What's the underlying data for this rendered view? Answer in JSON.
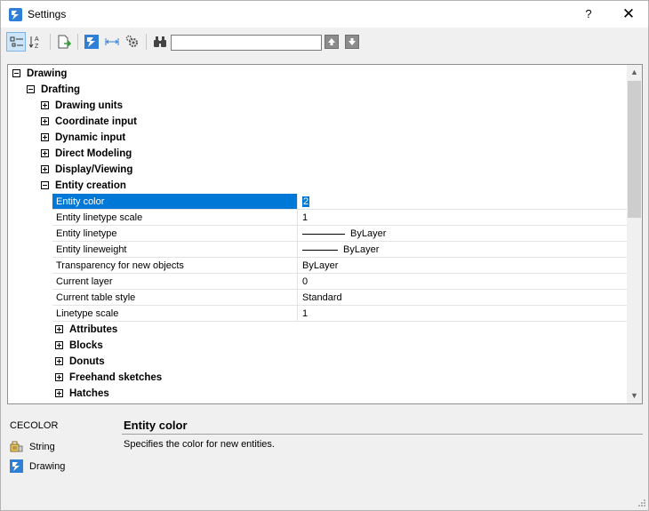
{
  "window": {
    "title": "Settings",
    "help_label": "?",
    "close_label": "✕"
  },
  "toolbar": {
    "buttons": [
      {
        "name": "categorized-view",
        "active": true
      },
      {
        "name": "alphabetical-view",
        "active": false
      },
      {
        "name": "export",
        "active": false
      },
      {
        "name": "drawing-settings",
        "active": false
      },
      {
        "name": "dimension-settings",
        "active": false
      },
      {
        "name": "program-options",
        "active": false
      },
      {
        "name": "find",
        "active": false
      }
    ],
    "search": {
      "value": "",
      "placeholder": ""
    }
  },
  "tree": {
    "nodes": [
      {
        "label": "Drawing",
        "state": "expanded",
        "level": 0
      },
      {
        "label": "Drafting",
        "state": "expanded",
        "level": 1
      },
      {
        "label": "Drawing units",
        "state": "collapsed",
        "level": 2
      },
      {
        "label": "Coordinate input",
        "state": "collapsed",
        "level": 2
      },
      {
        "label": "Dynamic input",
        "state": "collapsed",
        "level": 2
      },
      {
        "label": "Direct Modeling",
        "state": "collapsed",
        "level": 2
      },
      {
        "label": "Display/Viewing",
        "state": "collapsed",
        "level": 2
      },
      {
        "label": "Entity creation",
        "state": "expanded",
        "level": 2
      }
    ],
    "properties": [
      {
        "name": "Entity color",
        "value": "2",
        "selected": true,
        "line": false
      },
      {
        "name": "Entity linetype scale",
        "value": "1",
        "selected": false,
        "line": false
      },
      {
        "name": "Entity linetype",
        "value": "ByLayer",
        "selected": false,
        "line": true
      },
      {
        "name": "Entity lineweight",
        "value": "ByLayer",
        "selected": false,
        "line": true
      },
      {
        "name": "Transparency for new objects",
        "value": "ByLayer",
        "selected": false,
        "line": false
      },
      {
        "name": "Current layer",
        "value": "0",
        "selected": false,
        "line": false
      },
      {
        "name": "Current table style",
        "value": "Standard",
        "selected": false,
        "line": false
      },
      {
        "name": "Linetype scale",
        "value": "1",
        "selected": false,
        "line": false
      }
    ],
    "subnodes": [
      {
        "label": "Attributes",
        "state": "collapsed"
      },
      {
        "label": "Blocks",
        "state": "collapsed"
      },
      {
        "label": "Donuts",
        "state": "collapsed"
      },
      {
        "label": "Freehand sketches",
        "state": "collapsed"
      },
      {
        "label": "Hatches",
        "state": "collapsed"
      }
    ]
  },
  "description": {
    "variable": "CECOLOR",
    "type": "String",
    "scope": "Drawing",
    "title": "Entity color",
    "text": "Specifies the color for new entities."
  },
  "colors": {
    "selection": "#0078d7",
    "app_icon": "#2f7fd6"
  }
}
